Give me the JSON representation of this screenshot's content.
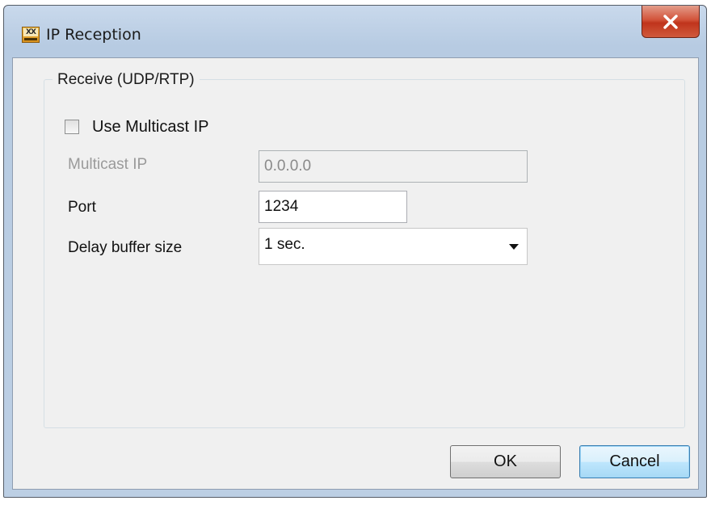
{
  "window": {
    "title": "IP Reception",
    "app_icon": "app-logo-icon",
    "close_icon": "close-icon"
  },
  "group": {
    "label": "Receive (UDP/RTP)"
  },
  "multicast_checkbox": {
    "label": "Use Multicast IP",
    "checked": false
  },
  "fields": {
    "multicast_ip_label": "Multicast IP",
    "multicast_ip_value": "0.0.0.0",
    "port_label": "Port",
    "port_value": "1234",
    "delay_label": "Delay buffer size",
    "delay_value": "1 sec."
  },
  "buttons": {
    "ok": "OK",
    "cancel": "Cancel"
  }
}
